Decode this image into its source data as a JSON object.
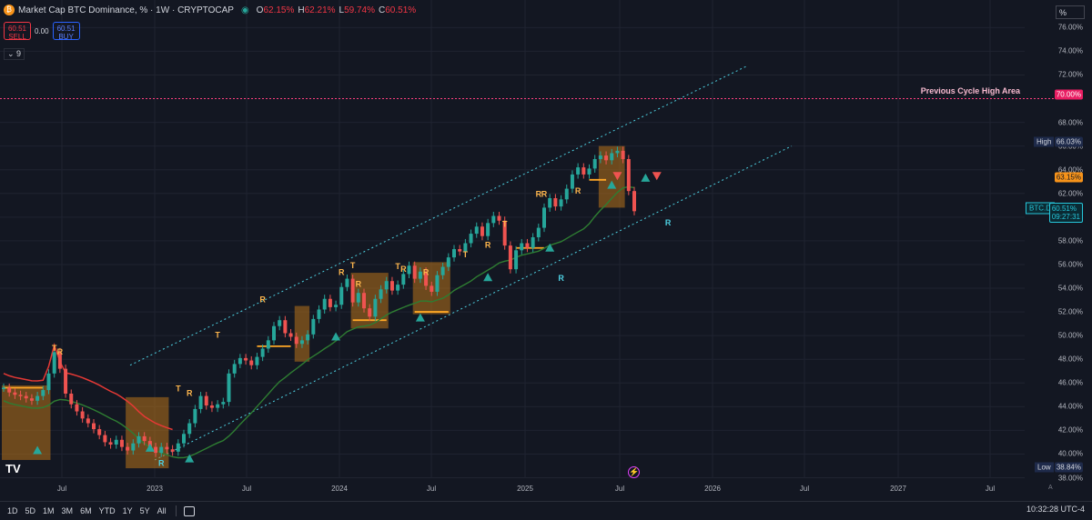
{
  "header": {
    "title": "Market Cap BTC Dominance, %",
    "interval": "1W",
    "source": "CRYPTOCAP",
    "ohlc": [
      {
        "k": "O",
        "v": "62.15%"
      },
      {
        "k": "H",
        "v": "62.21%"
      },
      {
        "k": "L",
        "v": "59.74%"
      },
      {
        "k": "C",
        "v": "60.51%"
      }
    ]
  },
  "trade": {
    "sell_price": "60.51",
    "sell_label": "SELL",
    "spread": "0.00",
    "buy_price": "60.51",
    "buy_label": "BUY"
  },
  "indicator_count": "9",
  "scale_mode": "%",
  "annotation": "Previous Cycle High Area",
  "price_tags": {
    "prev_high": "70.00%",
    "high_label": "High",
    "high_value": "66.03%",
    "trail": "63.15%",
    "symbol": "BTC.D",
    "last": "60.51%",
    "countdown": "09:27:31",
    "low_label": "Low",
    "low_value": "38.84%"
  },
  "y_ticks": [
    "38.00%",
    "40.00%",
    "42.00%",
    "44.00%",
    "46.00%",
    "48.00%",
    "50.00%",
    "52.00%",
    "54.00%",
    "56.00%",
    "58.00%",
    "60.00%",
    "62.00%",
    "64.00%",
    "66.00%",
    "68.00%",
    "72.00%",
    "74.00%",
    "76.00%"
  ],
  "x_ticks": [
    "Jul",
    "2023",
    "Jul",
    "2024",
    "Jul",
    "2025",
    "Jul",
    "2026",
    "Jul",
    "2027",
    "Jul"
  ],
  "ranges": [
    "1D",
    "5D",
    "1M",
    "3M",
    "6M",
    "YTD",
    "1Y",
    "5Y",
    "All"
  ],
  "clock": "10:32:28 UTC-4",
  "logo": "TV",
  "colors": {
    "up": "#26a69a",
    "down": "#ef5350",
    "trail": "#ef6c00",
    "box": "#b8731a",
    "ma": "#4caf50",
    "channel": "#4dd0e1",
    "prev": "#ff4081",
    "bg": "#131722"
  },
  "chart_data": {
    "type": "candlestick",
    "title": "Market Cap BTC Dominance, %",
    "interval": "1W",
    "x_range": [
      "2022-04",
      "2027-12"
    ],
    "ylim": [
      37.5,
      77
    ],
    "grid": true,
    "annotations": [
      "Previous Cycle High Area",
      "High 66.03%",
      "Low 38.84%"
    ],
    "reference_lines": [
      {
        "name": "Previous Cycle High Area",
        "y": 70.0
      }
    ],
    "channel": {
      "upper": [
        {
          "x": "2022-11",
          "y": 47.5
        },
        {
          "x": "2025-11",
          "y": 72.8
        }
      ],
      "lower": [
        {
          "x": "2023-01",
          "y": 39.5
        },
        {
          "x": "2025-11",
          "y": 66.0
        }
      ]
    },
    "candles_close": [
      45.6,
      45.2,
      45.0,
      44.9,
      44.7,
      44.5,
      44.9,
      45.4,
      46.8,
      48.6,
      47.2,
      45.1,
      44.2,
      43.6,
      43.0,
      42.6,
      42.1,
      41.6,
      41.0,
      40.8,
      41.2,
      40.6,
      40.3,
      40.9,
      41.5,
      41.1,
      40.6,
      40.1,
      40.6,
      40.4,
      40.2,
      40.9,
      41.7,
      42.6,
      43.8,
      44.9,
      44.1,
      43.9,
      44.2,
      44.4,
      46.8,
      47.6,
      48.1,
      47.9,
      47.5,
      48.2,
      48.9,
      49.6,
      50.8,
      51.3,
      50.2,
      49.9,
      49.3,
      49.6,
      50.1,
      51.4,
      52.2,
      53.1,
      52.4,
      52.6,
      54.1,
      54.8,
      52.8,
      53.6,
      52.3,
      51.6,
      53.1,
      53.9,
      54.6,
      53.8,
      54.3,
      55.2,
      55.9,
      54.8,
      55.4,
      54.2,
      53.7,
      55.1,
      55.8,
      56.6,
      57.3,
      57.1,
      57.8,
      58.6,
      59.2,
      58.4,
      59.5,
      60.1,
      59.7,
      57.6,
      55.6,
      57.2,
      57.8,
      57.4,
      58.3,
      59.1,
      60.8,
      61.6,
      60.9,
      61.5,
      62.4,
      63.6,
      64.2,
      63.6,
      64.1,
      64.9,
      65.2,
      64.8,
      65.4,
      65.6,
      64.9,
      62.2,
      60.5
    ]
  }
}
